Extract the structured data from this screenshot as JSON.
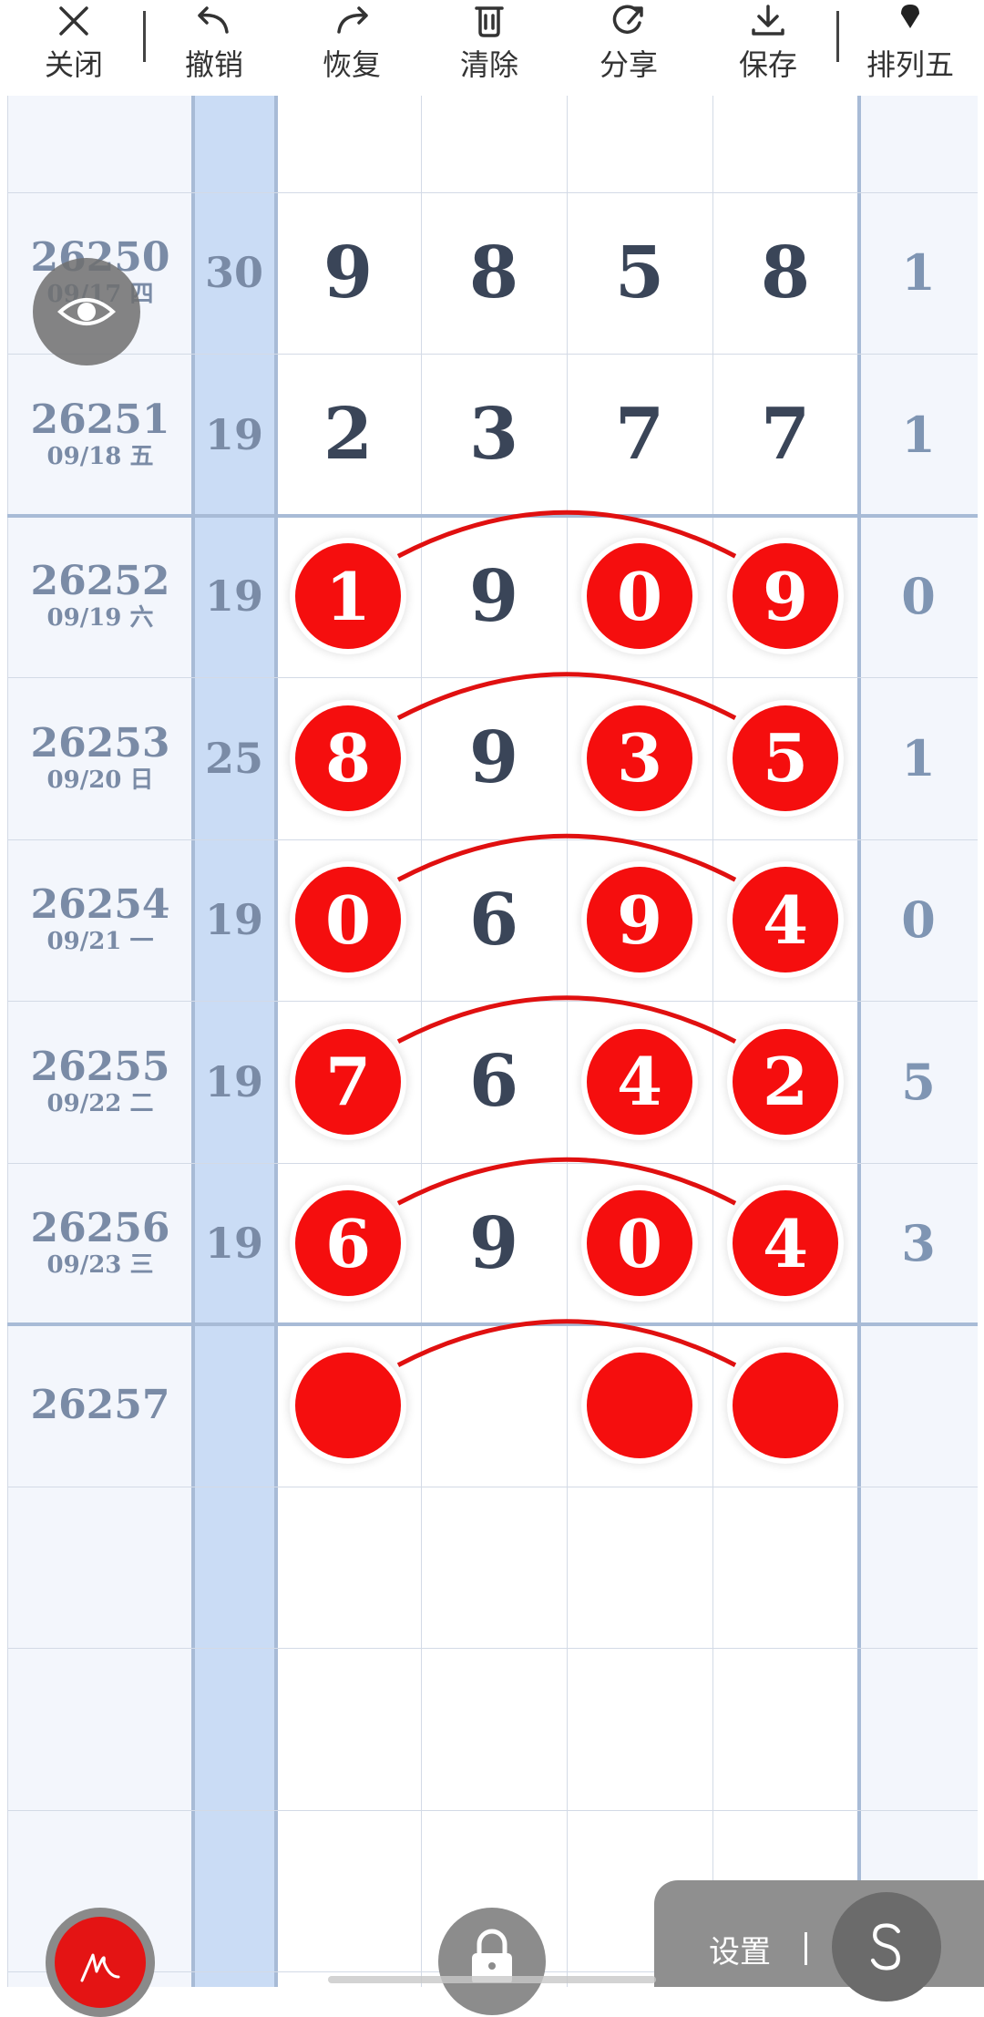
{
  "toolbar": {
    "items": [
      {
        "label": "关闭",
        "icon": "close-icon"
      },
      {
        "label": "撤销",
        "icon": "undo-icon"
      },
      {
        "label": "恢复",
        "icon": "redo-icon"
      },
      {
        "label": "清除",
        "icon": "trash-icon"
      },
      {
        "label": "分享",
        "icon": "share-icon"
      },
      {
        "label": "保存",
        "icon": "download-icon"
      },
      {
        "label": "排列五",
        "icon": "pin-icon"
      }
    ]
  },
  "colors": {
    "ball": "#f50e0e",
    "arc": "#e01010",
    "issue_text": "#7a8ba6",
    "digit_text": "#3a4558",
    "sum_column": "#cadcf5"
  },
  "rows": [
    {
      "issue": "26250",
      "date": "09/17 四",
      "sum": "30",
      "digits": [
        "9",
        "8",
        "5",
        "8"
      ],
      "marked": [
        false,
        false,
        false,
        false
      ],
      "extra": "1"
    },
    {
      "issue": "26251",
      "date": "09/18 五",
      "sum": "19",
      "digits": [
        "2",
        "3",
        "7",
        "7"
      ],
      "marked": [
        false,
        false,
        false,
        false
      ],
      "extra": "1"
    },
    {
      "issue": "26252",
      "date": "09/19 六",
      "sum": "19",
      "digits": [
        "1",
        "9",
        "0",
        "9"
      ],
      "marked": [
        true,
        false,
        true,
        true
      ],
      "extra": "0"
    },
    {
      "issue": "26253",
      "date": "09/20 日",
      "sum": "25",
      "digits": [
        "8",
        "9",
        "3",
        "5"
      ],
      "marked": [
        true,
        false,
        true,
        true
      ],
      "extra": "1"
    },
    {
      "issue": "26254",
      "date": "09/21 一",
      "sum": "19",
      "digits": [
        "0",
        "6",
        "9",
        "4"
      ],
      "marked": [
        true,
        false,
        true,
        true
      ],
      "extra": "0"
    },
    {
      "issue": "26255",
      "date": "09/22 二",
      "sum": "19",
      "digits": [
        "7",
        "6",
        "4",
        "2"
      ],
      "marked": [
        true,
        false,
        true,
        true
      ],
      "extra": "5"
    },
    {
      "issue": "26256",
      "date": "09/23 三",
      "sum": "19",
      "digits": [
        "6",
        "9",
        "0",
        "4"
      ],
      "marked": [
        true,
        false,
        true,
        true
      ],
      "extra": "3"
    },
    {
      "issue": "26257",
      "date": "",
      "sum": "",
      "digits": [
        "",
        "",
        "",
        ""
      ],
      "marked": [
        true,
        false,
        true,
        true
      ],
      "extra": ""
    }
  ],
  "controls": {
    "eye": "eye-icon",
    "pen": "pen-icon",
    "lock": "lock-icon",
    "settings_label": "设置",
    "s_button": "S"
  }
}
